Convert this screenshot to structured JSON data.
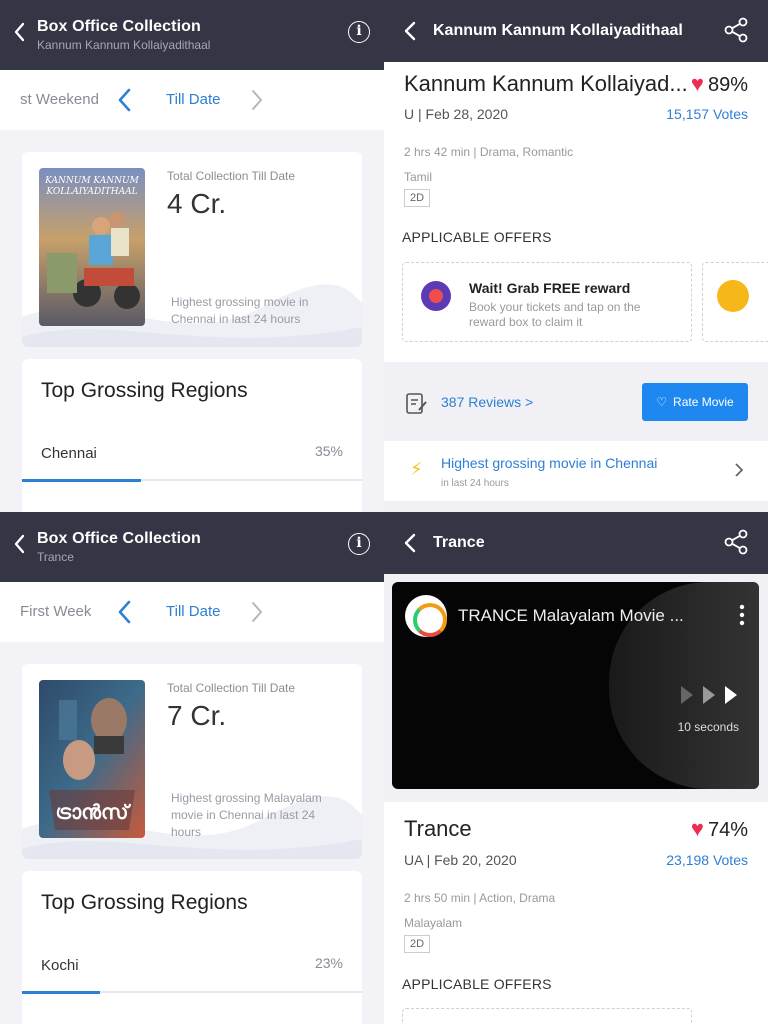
{
  "box_office_1": {
    "title": "Box Office Collection",
    "subtitle": "Kannum Kannum Kollaiyadithaal",
    "prev_period": "st Weekend",
    "current_period": "Till Date",
    "collection_label": "Total Collection Till Date",
    "collection_value": "4 Cr.",
    "collection_note": "Highest grossing movie in Chennai in last 24 hours",
    "poster_text": "KANNUM KANNUM KOLLAIYADITHAAL",
    "regions_title": "Top Grossing Regions",
    "region_name": "Chennai",
    "region_pct": "35%",
    "region_fraction": 0.35
  },
  "box_office_2": {
    "title": "Box Office Collection",
    "subtitle": "Trance",
    "prev_period": "First Week",
    "current_period": "Till Date",
    "collection_label": "Total Collection Till Date",
    "collection_value": "7 Cr.",
    "collection_note": "Highest grossing Malayalam movie in Chennai in last 24 hours",
    "poster_text": "ട്രാൻസ്",
    "regions_title": "Top Grossing Regions",
    "region_name": "Kochi",
    "region_pct": "23%",
    "region_fraction": 0.23
  },
  "movie_1": {
    "header_title": "Kannum Kannum Kollaiyadithaal",
    "title": "Kannum Kannum Kollaiyad...",
    "rating": "89%",
    "cert_date": "U | Feb 28, 2020",
    "votes": "15,157 Votes",
    "meta": "2 hrs 42 min | Drama, Romantic",
    "language": "Tamil",
    "format": "2D",
    "offers_heading": "APPLICABLE OFFERS",
    "offer_title": "Wait! Grab FREE reward",
    "offer_desc": "Book your tickets and tap on the reward box to claim it",
    "reviews": "387 Reviews >",
    "rate_button": "Rate Movie",
    "highlight_title": "Highest grossing movie in Chennai",
    "highlight_sub": "in last 24 hours"
  },
  "movie_2": {
    "header_title": "Trance",
    "video_title": "TRANCE Malayalam Movie ...",
    "video_seconds": "10 seconds",
    "title": "Trance",
    "rating": "74%",
    "cert_date": "UA | Feb 20, 2020",
    "votes": "23,198 Votes",
    "meta": "2 hrs 50 min | Action, Drama",
    "language": "Malayalam",
    "format": "2D",
    "offers_heading": "APPLICABLE OFFERS"
  },
  "colors": {
    "header_bg": "#343545",
    "accent_blue": "#2e7fd6",
    "button_blue": "#1e88f0",
    "heart": "#ec2e53"
  }
}
